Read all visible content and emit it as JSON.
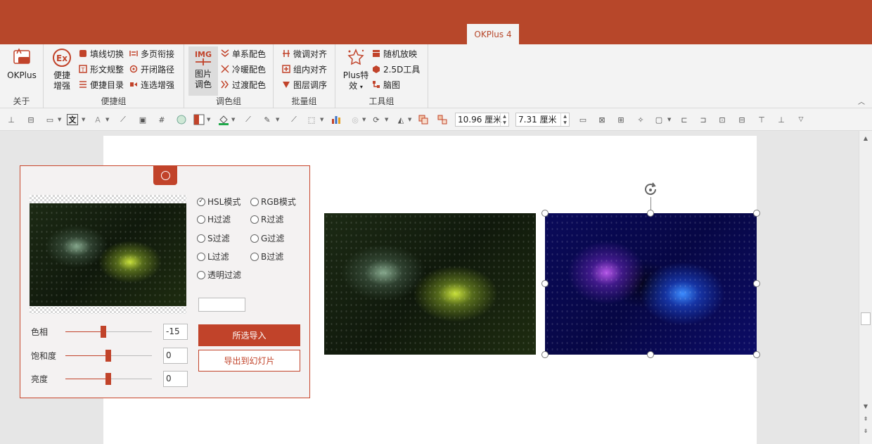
{
  "title_tab": "OKPlus 4",
  "ribbon": {
    "about": {
      "label": "关于",
      "okplus": "OKPlus",
      "logo_text": "Plus"
    },
    "shortcut": {
      "label": "便捷组",
      "big": "便捷\n增强",
      "big_line1": "便捷",
      "big_line2": "增强",
      "items": [
        "填线切换",
        "形文规整",
        "便捷目录",
        "多页衔接",
        "开闭路径",
        "连选增强"
      ]
    },
    "color": {
      "label": "调色组",
      "big_line1": "图片",
      "big_line2": "调色",
      "icon_text": "IMG",
      "items": [
        "单系配色",
        "冷暖配色",
        "过渡配色"
      ]
    },
    "batch": {
      "label": "批量组",
      "items": [
        "微调对齐",
        "组内对齐",
        "图层调序"
      ]
    },
    "tools": {
      "label": "工具组",
      "big_line1": "Plus特",
      "big_line2": "效",
      "items": [
        "随机放映",
        "2.5D工具",
        "脑图"
      ]
    }
  },
  "toolbar": {
    "width_value": "10.96 厘米",
    "height_value": "7.31 厘米"
  },
  "panel": {
    "radios": [
      {
        "label": "HSL模式",
        "checked": true
      },
      {
        "label": "RGB模式",
        "checked": false
      },
      {
        "label": "H过滤",
        "checked": false
      },
      {
        "label": "R过滤",
        "checked": false
      },
      {
        "label": "S过滤",
        "checked": false
      },
      {
        "label": "G过滤",
        "checked": false
      },
      {
        "label": "L过滤",
        "checked": false
      },
      {
        "label": "B过滤",
        "checked": false
      },
      {
        "label": "透明过滤",
        "checked": false
      }
    ],
    "sliders": [
      {
        "label": "色相",
        "value": "-15",
        "level": 0.44
      },
      {
        "label": "饱和度",
        "value": "0",
        "level": 0.5
      },
      {
        "label": "亮度",
        "value": "0",
        "level": 0.5
      }
    ],
    "import_button": "所选导入",
    "export_button": "导出到幻灯片"
  },
  "colors": {
    "accent": "#b7472a",
    "panel_accent": "#c1432a"
  }
}
